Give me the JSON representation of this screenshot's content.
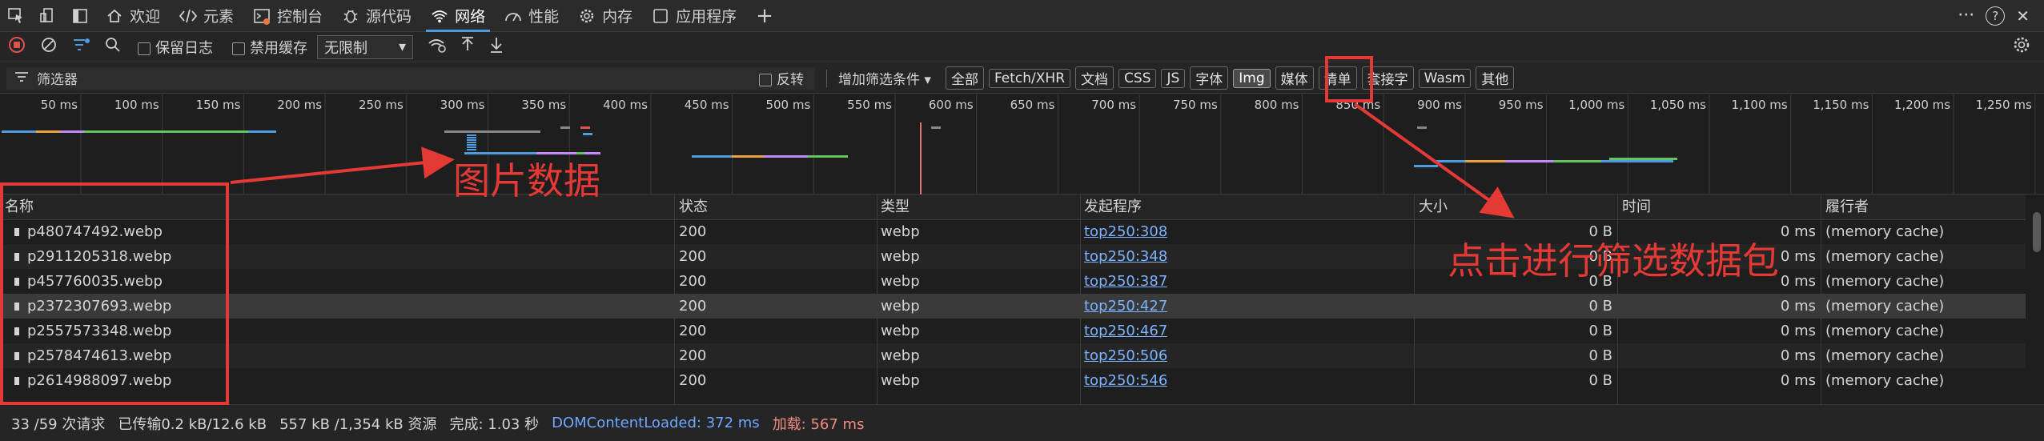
{
  "tabs": [
    {
      "label": "欢迎",
      "icon": "home-icon"
    },
    {
      "label": "元素",
      "icon": "code-icon"
    },
    {
      "label": "控制台",
      "icon": "console-icon"
    },
    {
      "label": "源代码",
      "icon": "bug-icon"
    },
    {
      "label": "网络",
      "icon": "wifi-icon",
      "active": true
    },
    {
      "label": "性能",
      "icon": "gauge-icon"
    },
    {
      "label": "内存",
      "icon": "gear-icon"
    },
    {
      "label": "应用程序",
      "icon": "app-icon"
    }
  ],
  "add_tab": "+",
  "tab_right": {
    "more": "···",
    "help": "?",
    "close": "✕"
  },
  "toolbar": {
    "preserve_log": "保留日志",
    "disable_cache": "禁用缓存",
    "throttle": "无限制"
  },
  "filter": {
    "placeholder": "筛选器",
    "invert": "反转",
    "add_filter": "增加筛选条件",
    "types": [
      "全部",
      "Fetch/XHR",
      "文档",
      "CSS",
      "JS",
      "字体",
      "Img",
      "媒体",
      "清单",
      "套接字",
      "Wasm",
      "其他"
    ],
    "active_type": "Img"
  },
  "timeline": {
    "ticks": [
      "50 ms",
      "100 ms",
      "150 ms",
      "200 ms",
      "250 ms",
      "300 ms",
      "350 ms",
      "400 ms",
      "450 ms",
      "500 ms",
      "550 ms",
      "600 ms",
      "650 ms",
      "700 ms",
      "750 ms",
      "800 ms",
      "850 ms",
      "900 ms",
      "950 ms",
      "1,000 ms",
      "1,050 ms",
      "1,100 ms",
      "1,150 ms",
      "1,200 ms",
      "1,250 ms"
    ]
  },
  "table": {
    "headers": [
      "名称",
      "状态",
      "类型",
      "发起程序",
      "大小",
      "时间",
      "履行者"
    ],
    "rows": [
      {
        "name": "p480747492.webp",
        "status": "200",
        "type": "webp",
        "initiator": "top250:308",
        "size": "0 B",
        "time": "0 ms",
        "fulfilled": "(memory cache)"
      },
      {
        "name": "p2911205318.webp",
        "status": "200",
        "type": "webp",
        "initiator": "top250:348",
        "size": "0 B",
        "time": "0 ms",
        "fulfilled": "(memory cache)"
      },
      {
        "name": "p457760035.webp",
        "status": "200",
        "type": "webp",
        "initiator": "top250:387",
        "size": "0 B",
        "time": "0 ms",
        "fulfilled": "(memory cache)"
      },
      {
        "name": "p2372307693.webp",
        "status": "200",
        "type": "webp",
        "initiator": "top250:427",
        "size": "0 B",
        "time": "0 ms",
        "fulfilled": "(memory cache)"
      },
      {
        "name": "p2557573348.webp",
        "status": "200",
        "type": "webp",
        "initiator": "top250:467",
        "size": "0 B",
        "time": "0 ms",
        "fulfilled": "(memory cache)"
      },
      {
        "name": "p2578474613.webp",
        "status": "200",
        "type": "webp",
        "initiator": "top250:506",
        "size": "0 B",
        "time": "0 ms",
        "fulfilled": "(memory cache)"
      },
      {
        "name": "p2614988097.webp",
        "status": "200",
        "type": "webp",
        "initiator": "top250:546",
        "size": "0 B",
        "time": "0 ms",
        "fulfilled": "(memory cache)"
      }
    ]
  },
  "status": {
    "requests": "33 /59 次请求",
    "transferred": "已传输0.2 kB/12.6 kB",
    "resources": "557 kB /1,354 kB 资源",
    "finish": "完成: 1.03 秒",
    "dcl": "DOMContentLoaded: 372 ms",
    "load": "加载: 567 ms"
  },
  "annotations": {
    "image_data": "图片数据",
    "click_filter": "点击进行筛选数据包"
  },
  "colors": {
    "accent": "#4e9cdd",
    "annotation": "#e53935",
    "link": "#7cb3ff"
  }
}
